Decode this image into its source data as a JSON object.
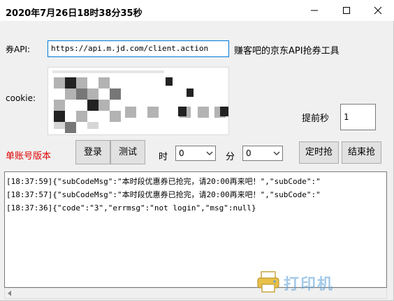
{
  "window": {
    "title": "2020年7月26日18时38分35秒",
    "controls": [
      "minimize-icon",
      "maximize-icon",
      "close-icon"
    ]
  },
  "form": {
    "api_label": "券API:",
    "api_value": "https://api.m.jd.com/client.action",
    "tool_caption": "赚客吧的京东API抢券工具",
    "cookie_label": "cookie:",
    "advance_label": "提前秒",
    "advance_value": "1",
    "mode_label": "单账号版本",
    "login_button": "登录",
    "test_button": "测试",
    "hour_label": "时",
    "hour_value": "0",
    "minute_label": "分",
    "minute_value": "0",
    "timed_button": "定时抢",
    "stop_button": "结束抢"
  },
  "log": {
    "lines": [
      "[18:37:59]{\"subCodeMsg\":\"本时段优惠券已抢完，请20:00再来吧！\",\"subCode\":\"",
      "[18:37:57]{\"subCodeMsg\":\"本时段优惠券已抢完，请20:00再来吧！\",\"subCode\":\"",
      "[18:37:36]{\"code\":\"3\",\"errmsg\":\"not login\",\"msg\":null}"
    ]
  },
  "watermark": {
    "text": "打印机",
    "icon": "printer-icon"
  },
  "colors": {
    "accent": "#0078d7",
    "red_label": "#e00000",
    "window_bg": "#f0f0f0"
  }
}
